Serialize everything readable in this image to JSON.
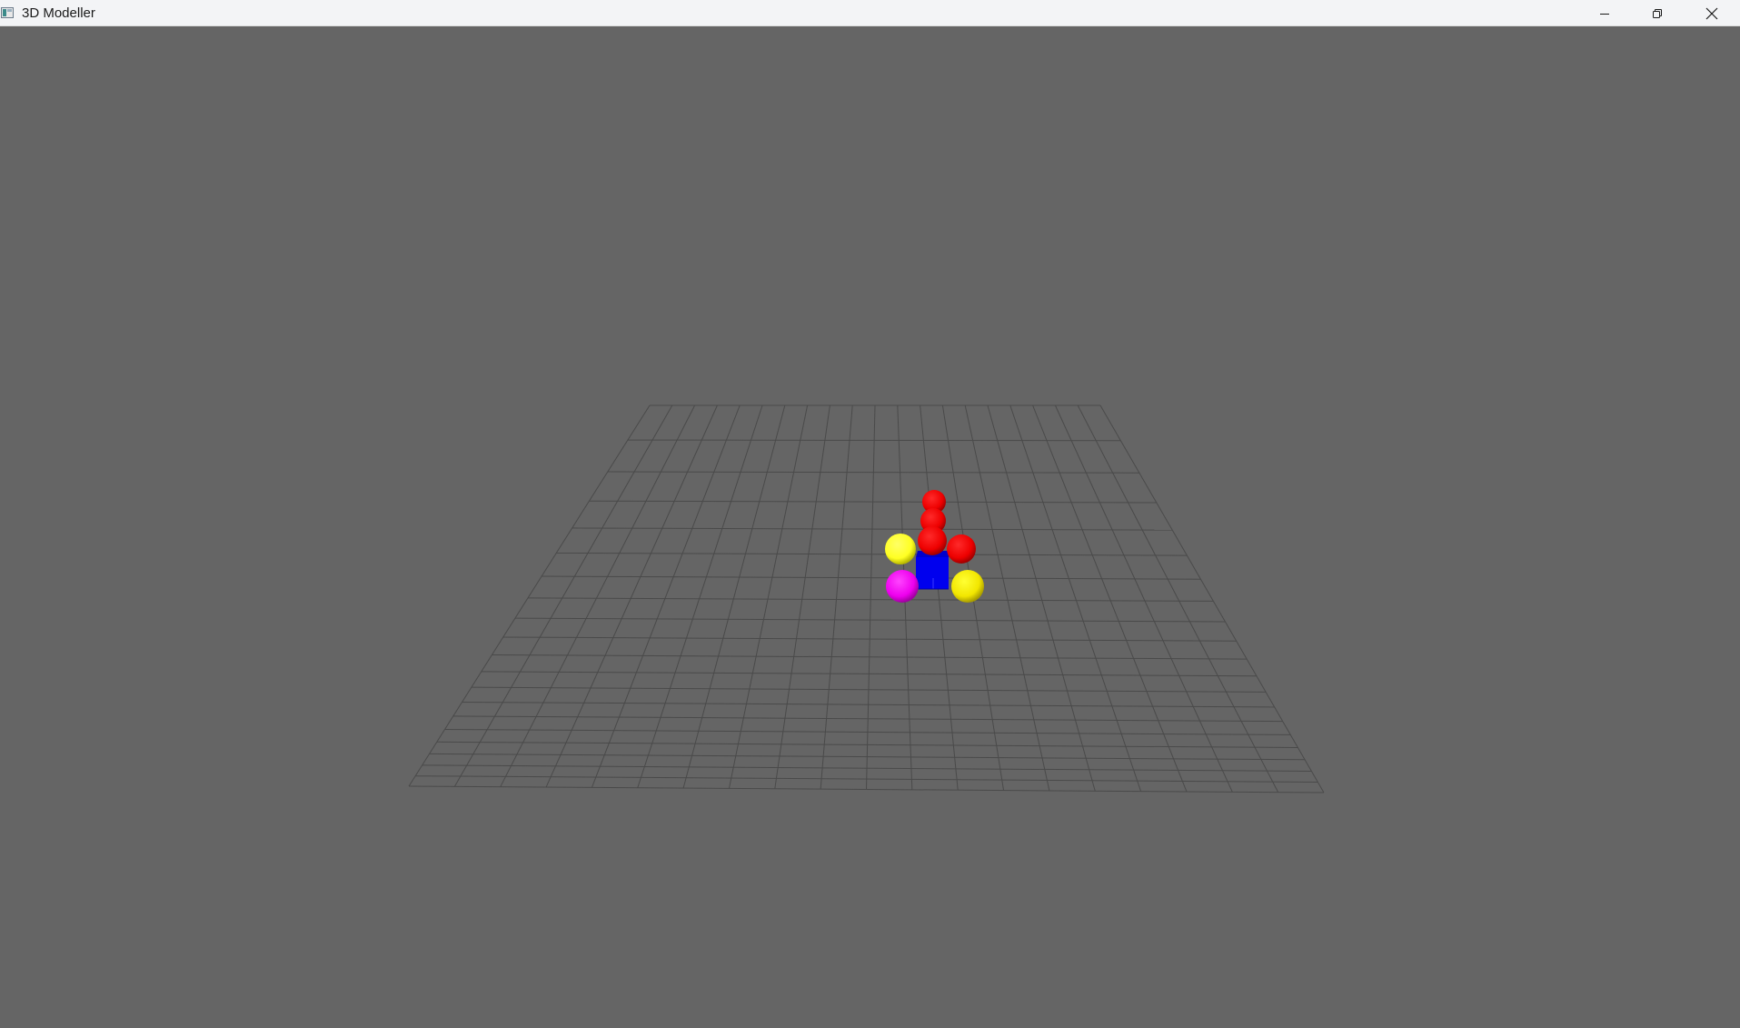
{
  "window": {
    "title": "3D Modeller"
  },
  "caption_buttons": {
    "minimize": "minimize-icon",
    "restore": "restore-icon",
    "close": "close-icon"
  },
  "scene": {
    "background_color": "#656565",
    "grid_color": "#4a4a4a",
    "objects": [
      {
        "name": "cube",
        "color": "#0000ff"
      },
      {
        "name": "sphere-top",
        "color": "#ff0000"
      },
      {
        "name": "sphere-upper",
        "color": "#ff0000"
      },
      {
        "name": "sphere-center",
        "color": "#ff0000"
      },
      {
        "name": "sphere-right",
        "color": "#ff0000"
      },
      {
        "name": "sphere-left-yellow",
        "color": "#ffff33"
      },
      {
        "name": "sphere-magenta",
        "color": "#ff00ff"
      },
      {
        "name": "sphere-right-yellow",
        "color": "#ffee00"
      }
    ]
  }
}
